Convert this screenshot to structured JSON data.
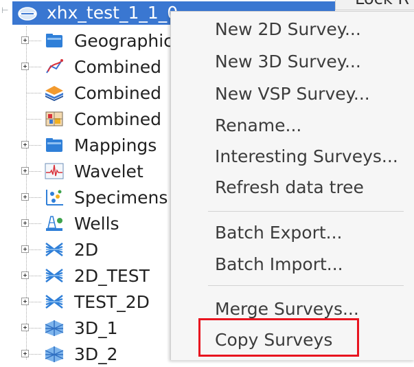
{
  "tree": {
    "root": {
      "label": "xhx_test_1_1_0",
      "icon": "survey-root-icon"
    },
    "items": [
      {
        "label": "Geographic",
        "icon": "blue-folder-icon",
        "expandable": true
      },
      {
        "label": "Combined",
        "icon": "combined-pen-icon",
        "expandable": true
      },
      {
        "label": "Combined",
        "icon": "layers-stack-icon",
        "expandable": false
      },
      {
        "label": "Combined",
        "icon": "combined-grid-icon",
        "expandable": false
      },
      {
        "label": "Mappings",
        "icon": "blue-folder-icon",
        "expandable": true
      },
      {
        "label": "Wavelet",
        "icon": "wavelet-icon",
        "expandable": true
      },
      {
        "label": "Specimens",
        "icon": "specimens-icon",
        "expandable": true
      },
      {
        "label": "Wells",
        "icon": "wells-icon",
        "expandable": true
      },
      {
        "label": "2D",
        "icon": "2d-survey-icon",
        "expandable": true
      },
      {
        "label": "2D_TEST",
        "icon": "2d-survey-icon",
        "expandable": true
      },
      {
        "label": "TEST_2D",
        "icon": "2d-survey-icon",
        "expandable": true
      },
      {
        "label": "3D_1",
        "icon": "3d-survey-icon",
        "expandable": true
      },
      {
        "label": "3D_2",
        "icon": "3d-survey-icon",
        "expandable": true
      }
    ]
  },
  "top_tab": {
    "label": "Lock R"
  },
  "context_menu": {
    "items": [
      {
        "label": "New 2D Survey..."
      },
      {
        "label": "New 3D Survey..."
      },
      {
        "label": "New VSP Survey..."
      },
      {
        "label": "Rename..."
      },
      {
        "label": "Interesting Surveys..."
      },
      {
        "label": "Refresh data tree"
      },
      {
        "label": "Batch Export..."
      },
      {
        "label": "Batch Import..."
      },
      {
        "label": "Merge Surveys..."
      },
      {
        "label": "Copy Surveys"
      }
    ],
    "highlighted_item": "Copy Surveys"
  },
  "colors": {
    "selection": "#3a77d1",
    "highlight_box": "#e8141f",
    "menu_background": "#f6f6f6"
  }
}
